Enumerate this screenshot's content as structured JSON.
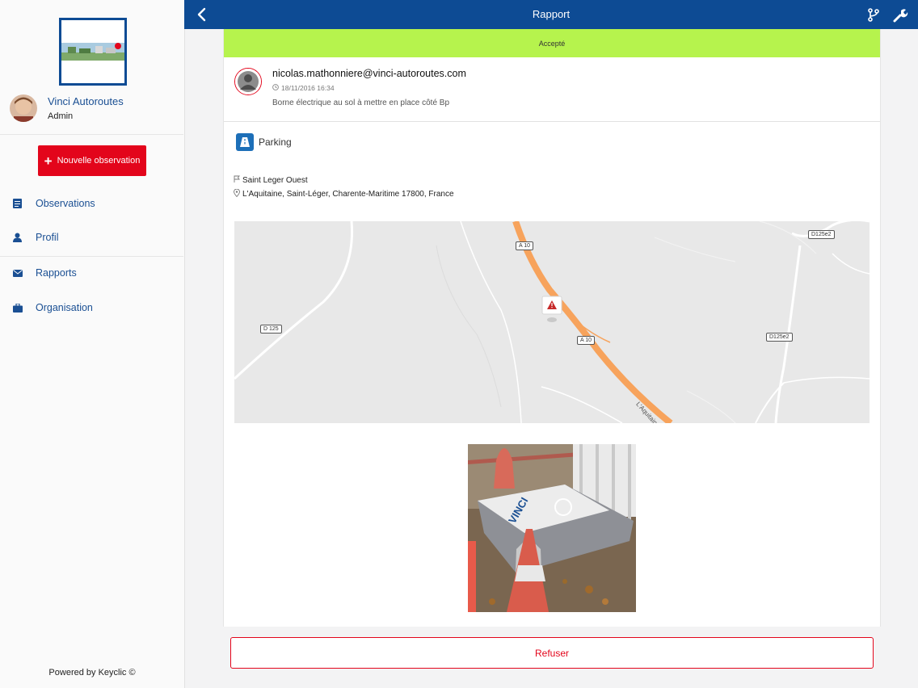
{
  "sidebar": {
    "org_name": "Vinci Autoroutes",
    "user_role": "Admin",
    "new_observation_label": "Nouvelle observation",
    "nav": [
      {
        "label": "Observations",
        "icon": "document-icon"
      },
      {
        "label": "Profil",
        "icon": "user-icon"
      },
      {
        "label": "Rapports",
        "icon": "envelope-icon"
      },
      {
        "label": "Organisation",
        "icon": "briefcase-icon"
      }
    ],
    "footer": "Powered by Keyclic ©"
  },
  "header": {
    "title": "Rapport"
  },
  "report": {
    "status": "Accepté",
    "status_color": "#b6f34d",
    "author_email": "nicolas.mathonniere@vinci-autoroutes.com",
    "date": "18/11/2016 16:34",
    "description": "Borne électrique au sol à mettre en place côté Bp",
    "category": "Parking",
    "place": "Saint Leger Ouest",
    "address": "L'Aquitaine, Saint-Léger, Charente-Maritime 17800, France"
  },
  "map": {
    "labels": {
      "a10_top": "A 10",
      "a10_mid": "A 10",
      "d125": "D 125",
      "d125e2_top": "D125e2",
      "d125e2_mid": "D125e2",
      "aquitaine": "L'Aquitaine"
    }
  },
  "actions": {
    "refuse_label": "Refuser"
  },
  "colors": {
    "brand_blue": "#0d4b94",
    "accent_red": "#e3051b",
    "highway_orange": "#f7a35c"
  }
}
